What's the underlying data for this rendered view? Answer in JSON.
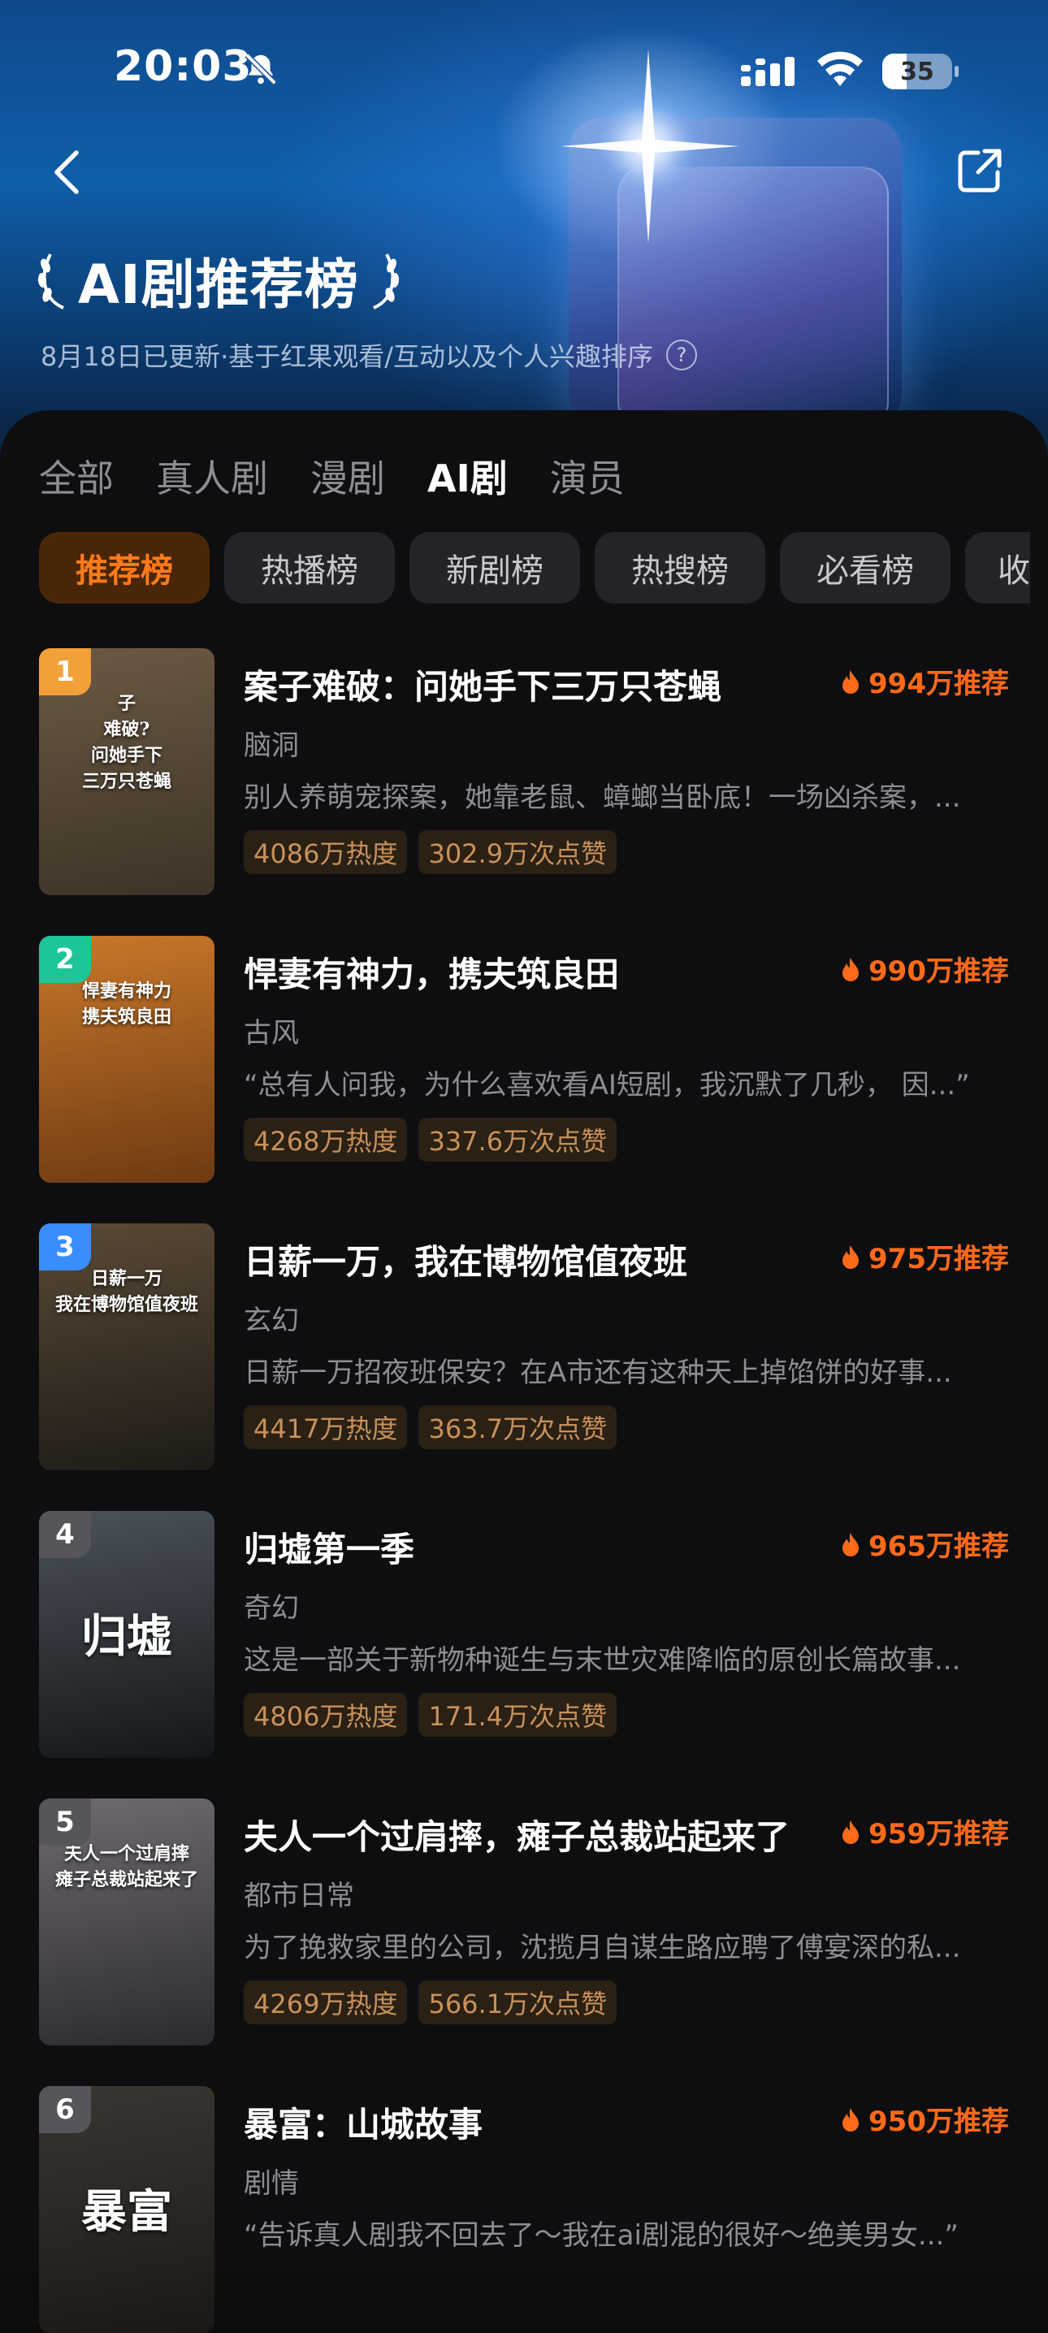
{
  "status": {
    "time": "20:03",
    "battery": "35",
    "battery_level": 0.35
  },
  "header": {
    "title": "AI剧推荐榜",
    "subtitle": "8月18日已更新·基于红果观看/互动以及个人兴趣排序",
    "info_glyph": "?"
  },
  "category_tabs": [
    {
      "label": "全部"
    },
    {
      "label": "真人剧"
    },
    {
      "label": "漫剧"
    },
    {
      "label": "AI剧",
      "active": true
    },
    {
      "label": "演员"
    }
  ],
  "rank_tabs": [
    {
      "label": "推荐榜",
      "active": true
    },
    {
      "label": "热播榜"
    },
    {
      "label": "新剧榜"
    },
    {
      "label": "热搜榜"
    },
    {
      "label": "必看榜"
    },
    {
      "label": "收"
    }
  ],
  "items": [
    {
      "rank": "1",
      "title": "案子难破：问她手下三万只苍蝇",
      "recommend": "994万推荐",
      "genre": "脑洞",
      "desc": "别人养萌宠探案，她靠老鼠、蟑螂当卧底！一场凶杀案，...",
      "tags": [
        "4086万热度",
        "302.9万次点赞"
      ],
      "poster_text": "子\n难破?\n问她手下\n三万只苍蝇",
      "rank_color": "#f2a13a",
      "poster_colors": [
        "#6b5a44",
        "#3d3326"
      ]
    },
    {
      "rank": "2",
      "title": "悍妻有神力，携夫筑良田",
      "recommend": "990万推荐",
      "genre": "古风",
      "desc": "“总有人问我，为什么喜欢看AI短剧，我沉默了几秒， 因...”",
      "tags": [
        "4268万热度",
        "337.6万次点赞"
      ],
      "poster_text": "悍妻有神力\n携夫筑良田",
      "rank_color": "#1fc59a",
      "poster_colors": [
        "#c9782a",
        "#6e3a12"
      ]
    },
    {
      "rank": "3",
      "title": "日薪一万，我在博物馆值夜班",
      "recommend": "975万推荐",
      "genre": "玄幻",
      "desc": "日薪一万招夜班保安？在A市还有这种天上掉馅饼的好事...",
      "tags": [
        "4417万热度",
        "363.7万次点赞"
      ],
      "poster_text": "日薪一万\n我在博物馆值夜班",
      "rank_color": "#3a8dff",
      "poster_colors": [
        "#5a4a36",
        "#1d1a16"
      ]
    },
    {
      "rank": "4",
      "title": "归墟第一季",
      "recommend": "965万推荐",
      "genre": "奇幻",
      "desc": "这是一部关于新物种诞生与末世灾难降临的原创长篇故事...",
      "tags": [
        "4806万热度",
        "171.4万次点赞"
      ],
      "poster_text": "归墟",
      "rank_color": "#55555a",
      "poster_colors": [
        "#4b5259",
        "#14171a"
      ]
    },
    {
      "rank": "5",
      "title": "夫人一个过肩摔，瘫子总裁站起来了",
      "recommend": "959万推荐",
      "genre": "都市日常",
      "desc": "为了挽救家里的公司，沈揽月自谋生路应聘了傅宴深的私...",
      "tags": [
        "4269万热度",
        "566.1万次点赞"
      ],
      "poster_text": "夫人一个过肩摔\n瘫子总裁站起来了",
      "rank_color": "#55555a",
      "poster_colors": [
        "#6e6a70",
        "#2c2a30"
      ]
    },
    {
      "rank": "6",
      "title": "暴富：山城故事",
      "recommend": "950万推荐",
      "genre": "剧情",
      "desc": "“告诉真人剧我不回去了～我在ai剧混的很好～绝美男女...”",
      "tags": [],
      "poster_text": "暴富",
      "rank_color": "#55555a",
      "poster_colors": [
        "#3a3632",
        "#1a1816"
      ]
    }
  ],
  "colors": {
    "accent": "#ff6a1a",
    "tag_text": "#c8915a",
    "tag_bg": "#2a2014",
    "chip_active_bg": "#4a2608"
  },
  "icons": {
    "back": "chevron-left-icon",
    "share": "share-icon",
    "mute": "bell-slash-icon",
    "fire": "fire-icon"
  }
}
